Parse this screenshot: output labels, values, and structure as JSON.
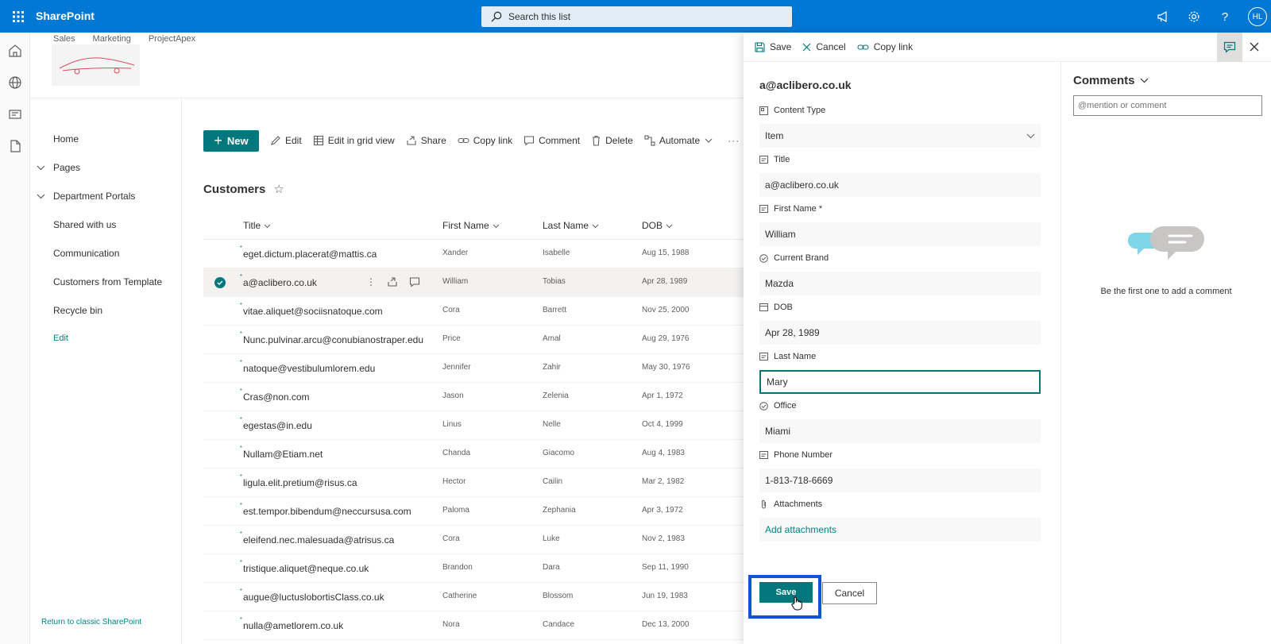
{
  "suite": {
    "brand": "SharePoint",
    "search_placeholder": "Search this list",
    "avatar_initials": "HL"
  },
  "hub_nav": [
    "Sales",
    "Marketing",
    "ProjectApex"
  ],
  "left_nav": {
    "items": [
      "Home",
      "Pages",
      "Department Portals",
      "Shared with us",
      "Communication",
      "Customers from Template",
      "Recycle bin",
      "Edit"
    ],
    "return_link": "Return to classic SharePoint"
  },
  "command_bar": {
    "new": "New",
    "edit": "Edit",
    "grid": "Edit in grid view",
    "share": "Share",
    "copy_link": "Copy link",
    "comment": "Comment",
    "delete": "Delete",
    "automate": "Automate"
  },
  "list": {
    "title": "Customers",
    "columns": [
      "Title",
      "First Name",
      "Last Name",
      "DOB"
    ],
    "rows": [
      {
        "title": "eget.dictum.placerat@mattis.ca",
        "first": "Xander",
        "last": "Isabelle",
        "dob": "Aug 15, 1988"
      },
      {
        "title": "a@aclibero.co.uk",
        "first": "William",
        "last": "Tobias",
        "dob": "Apr 28, 1989"
      },
      {
        "title": "vitae.aliquet@sociisnatoque.com",
        "first": "Cora",
        "last": "Barrett",
        "dob": "Nov 25, 2000"
      },
      {
        "title": "Nunc.pulvinar.arcu@conubianostraper.edu",
        "first": "Price",
        "last": "Amal",
        "dob": "Aug 29, 1976"
      },
      {
        "title": "natoque@vestibulumlorem.edu",
        "first": "Jennifer",
        "last": "Zahir",
        "dob": "May 30, 1976"
      },
      {
        "title": "Cras@non.com",
        "first": "Jason",
        "last": "Zelenia",
        "dob": "Apr 1, 1972"
      },
      {
        "title": "egestas@in.edu",
        "first": "Linus",
        "last": "Nelle",
        "dob": "Oct 4, 1999"
      },
      {
        "title": "Nullam@Etiam.net",
        "first": "Chanda",
        "last": "Giacomo",
        "dob": "Aug 4, 1983"
      },
      {
        "title": "ligula.elit.pretium@risus.ca",
        "first": "Hector",
        "last": "Cailin",
        "dob": "Mar 2, 1982"
      },
      {
        "title": "est.tempor.bibendum@neccursusa.com",
        "first": "Paloma",
        "last": "Zephania",
        "dob": "Apr 3, 1972"
      },
      {
        "title": "eleifend.nec.malesuada@atrisus.ca",
        "first": "Cora",
        "last": "Luke",
        "dob": "Nov 2, 1983"
      },
      {
        "title": "tristique.aliquet@neque.co.uk",
        "first": "Brandon",
        "last": "Dara",
        "dob": "Sep 11, 1990"
      },
      {
        "title": "augue@luctuslobortisClass.co.uk",
        "first": "Catherine",
        "last": "Blossom",
        "dob": "Jun 19, 1983"
      },
      {
        "title": "nulla@ametlorem.co.uk",
        "first": "Nora",
        "last": "Candace",
        "dob": "Dec 13, 2000"
      }
    ]
  },
  "panel": {
    "save": "Save",
    "cancel": "Cancel",
    "copy_link": "Copy link",
    "item_title": "a@aclibero.co.uk",
    "fields": [
      {
        "label": "Content Type",
        "value": "Item"
      },
      {
        "label": "Title",
        "value": "a@aclibero.co.uk"
      },
      {
        "label": "First Name *",
        "value": "William"
      },
      {
        "label": "Current Brand",
        "value": "Mazda"
      },
      {
        "label": "DOB",
        "value": "Apr 28, 1989"
      },
      {
        "label": "Last Name",
        "value": "Mary"
      },
      {
        "label": "Office",
        "value": "Miami"
      },
      {
        "label": "Phone Number",
        "value": "1-813-718-6669"
      },
      {
        "label": "Attachments",
        "value": "Add attachments"
      }
    ],
    "form_save": "Save",
    "form_cancel": "Cancel"
  },
  "comments": {
    "heading": "Comments",
    "placeholder": "@mention or comment",
    "empty": "Be the first one to add a comment"
  },
  "colors": {
    "suite_blue": "#0078d4",
    "theme_teal": "#03787c",
    "highlight_blue": "#0b57d0"
  }
}
